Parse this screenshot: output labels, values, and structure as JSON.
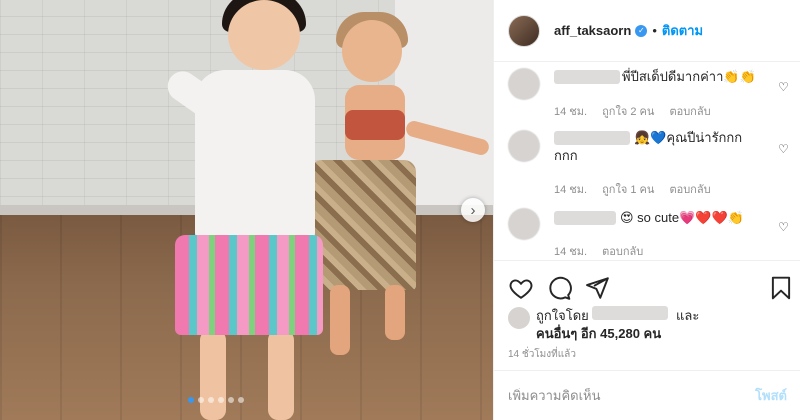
{
  "header": {
    "username": "aff_taksaorn",
    "verified_badge": "✓",
    "separator": "•",
    "follow_label": "ติดตาม"
  },
  "comments": [
    {
      "text": "พี่ปีสเด็ปดีมากค่าา👏👏",
      "time": "14 ชม.",
      "likes": "ถูกใจ 2 คน",
      "reply": "ตอบกลับ"
    },
    {
      "text_line1": "👧💙คุณปีน่ารักกก",
      "text_line2": "กกก",
      "time": "14 ชม.",
      "likes": "ถูกใจ 1 คน",
      "reply": "ตอบกลับ"
    },
    {
      "text": "😍 so cute💗❤️❤️👏",
      "time": "14 ชม.",
      "reply": "ตอบกลับ"
    }
  ],
  "likes": {
    "liked_by": "ถูกใจโดย",
    "and": "และ",
    "others": "คนอื่นๆ อีก 45,280 คน"
  },
  "post_time": "14 ชั่วโมงที่แล้ว",
  "add_comment": {
    "placeholder": "เพิ่มความคิดเห็น",
    "post_label": "โพสต์"
  },
  "media": {
    "next_icon": "›",
    "carousel_dots": 6,
    "active_dot": 0
  },
  "icons": {
    "like": "heart-icon",
    "comment": "comment-icon",
    "share": "share-icon",
    "save": "bookmark-icon"
  }
}
